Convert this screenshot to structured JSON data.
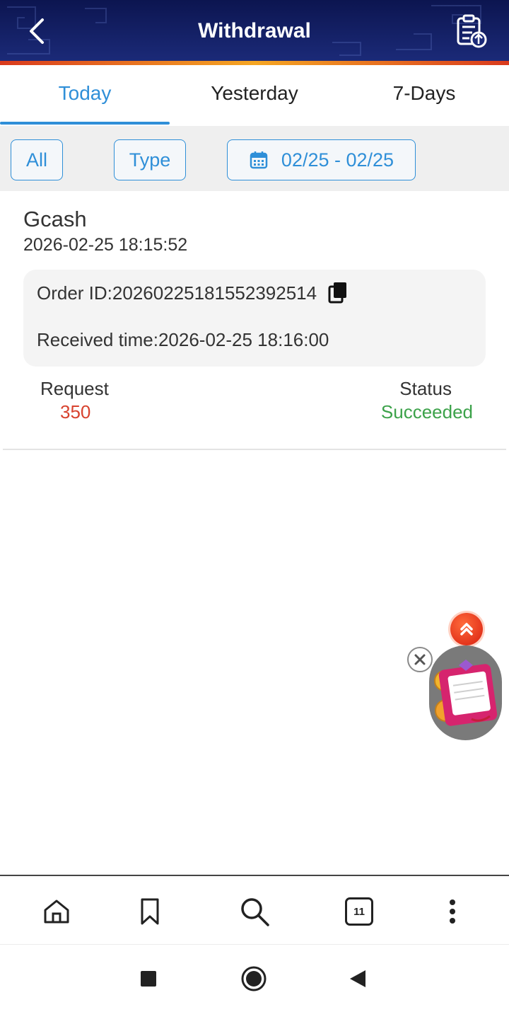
{
  "header": {
    "title": "Withdrawal",
    "back_icon": "chevron-left-icon",
    "report_icon": "clipboard-upload-icon"
  },
  "tabs": [
    {
      "label": "Today",
      "active": true
    },
    {
      "label": "Yesterday",
      "active": false
    },
    {
      "label": "7-Days",
      "active": false
    }
  ],
  "filters": {
    "all_label": "All",
    "type_label": "Type",
    "date_range": "02/25 - 02/25",
    "accent": "#2f8fd8"
  },
  "record": {
    "method": "Gcash",
    "datetime": "2026-02-25 18:15:52",
    "order_id_line": "Order ID:20260225181552392514",
    "received_line": "Received time:2026-02-25 18:16:00",
    "request_label": "Request",
    "request_value": "350",
    "status_label": "Status",
    "status_value": "Succeeded",
    "request_color": "#d8432f",
    "status_color": "#3ca24a"
  },
  "browser_bar": {
    "tabs_count": "11"
  }
}
